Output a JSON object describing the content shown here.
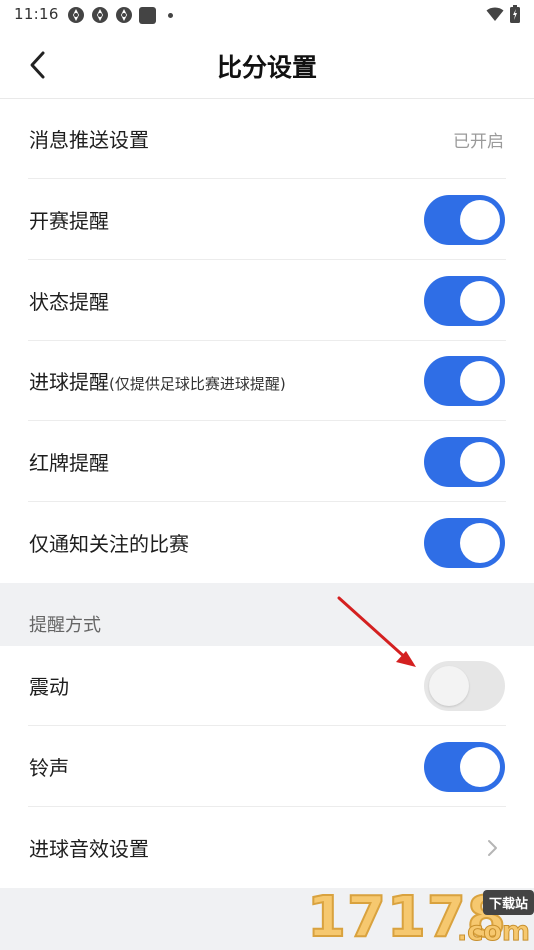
{
  "status_bar": {
    "time": "11:16",
    "icons": [
      "app-notification-icon",
      "app-notification-icon",
      "app-notification-icon",
      "square-notification-icon",
      "dot-icon",
      "wifi-icon",
      "battery-charging-icon"
    ]
  },
  "header": {
    "title": "比分设置",
    "back_icon": "chevron-left-icon"
  },
  "settings": {
    "push": {
      "label": "消息推送设置",
      "value": "已开启"
    },
    "match_start": {
      "label": "开赛提醒",
      "enabled": true
    },
    "status": {
      "label": "状态提醒",
      "enabled": true
    },
    "goal": {
      "label": "进球提醒",
      "note": "(仅提供足球比赛进球提醒)",
      "enabled": true
    },
    "red_card": {
      "label": "红牌提醒",
      "enabled": true
    },
    "followed_only": {
      "label": "仅通知关注的比赛",
      "enabled": true
    }
  },
  "reminder_method": {
    "section_title": "提醒方式",
    "vibrate": {
      "label": "震动",
      "enabled": false
    },
    "ringtone": {
      "label": "铃声",
      "enabled": true
    },
    "goal_sound": {
      "label": "进球音效设置"
    }
  },
  "colors": {
    "toggle_on": "#2f6ee6",
    "toggle_off": "#e6e6e6",
    "annotation_arrow": "#d42020",
    "section_bg": "#f0f1f3"
  },
  "watermark": {
    "digits": "17178",
    "badge": "下载站",
    "suffix": ".com"
  }
}
